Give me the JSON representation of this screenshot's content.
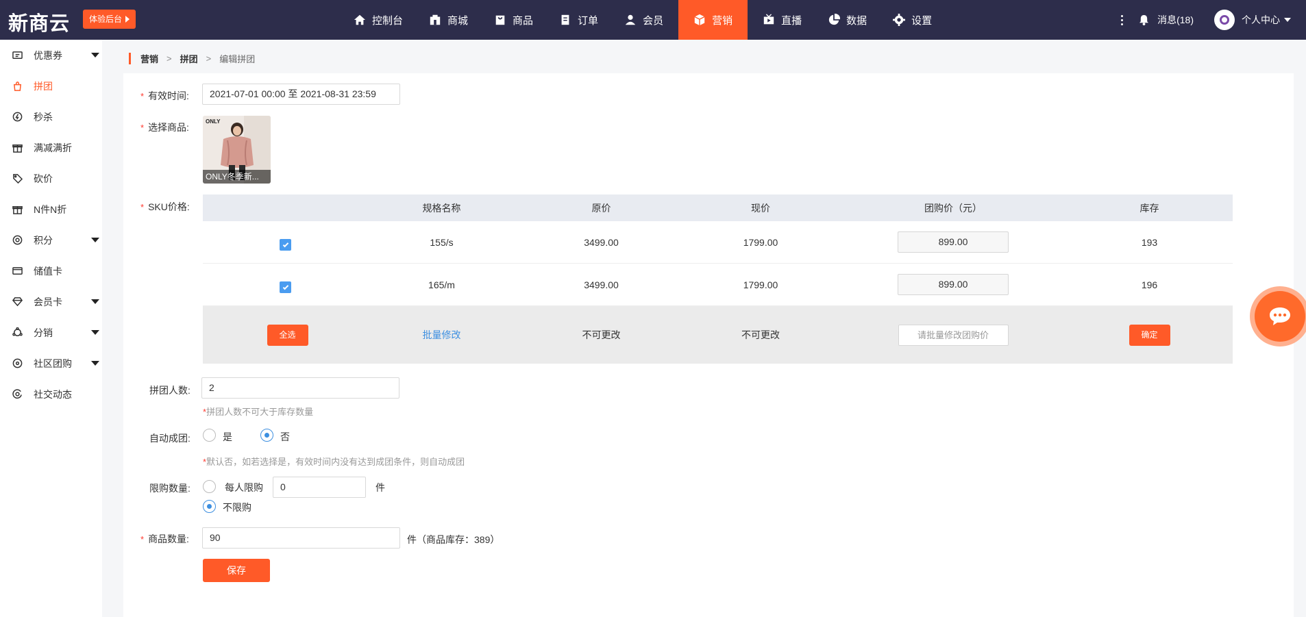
{
  "header": {
    "logo": "新商云",
    "trial_button": "体验后台",
    "nav": [
      {
        "label": "控制台",
        "icon": "home-icon"
      },
      {
        "label": "商城",
        "icon": "store-icon"
      },
      {
        "label": "商品",
        "icon": "bag-icon"
      },
      {
        "label": "订单",
        "icon": "order-icon"
      },
      {
        "label": "会员",
        "icon": "user-icon"
      },
      {
        "label": "营销",
        "icon": "cube-icon",
        "active": true
      },
      {
        "label": "直播",
        "icon": "live-icon"
      },
      {
        "label": "数据",
        "icon": "pie-chart-icon"
      },
      {
        "label": "设置",
        "icon": "gear-icon"
      }
    ],
    "messages": "消息(18)",
    "user_center": "个人中心"
  },
  "sidebar": {
    "items": [
      {
        "label": "优惠券",
        "icon": "coupon-icon",
        "has_caret": true
      },
      {
        "label": "拼团",
        "icon": "group-buy-icon",
        "active": true
      },
      {
        "label": "秒杀",
        "icon": "flash-icon"
      },
      {
        "label": "满减满折",
        "icon": "gift-icon"
      },
      {
        "label": "砍价",
        "icon": "tag-icon"
      },
      {
        "label": "N件N折",
        "icon": "gift-icon"
      },
      {
        "label": "积分",
        "icon": "points-icon",
        "has_caret": true
      },
      {
        "label": "储值卡",
        "icon": "card-icon"
      },
      {
        "label": "会员卡",
        "icon": "diamond-icon",
        "has_caret": true
      },
      {
        "label": "分销",
        "icon": "share-icon",
        "has_caret": true
      },
      {
        "label": "社区团购",
        "icon": "community-icon",
        "has_caret": true
      },
      {
        "label": "社交动态",
        "icon": "social-icon"
      }
    ]
  },
  "breadcrumb": {
    "first": "营销",
    "second": "拼团",
    "third": "编辑拼团",
    "sep": ">"
  },
  "form": {
    "valid_time": {
      "label": "有效时间:",
      "value": "2021-07-01 00:00 至 2021-08-31 23:59"
    },
    "product": {
      "label": "选择商品:",
      "brand": "ONLY",
      "caption": "ONLY冬季新..."
    },
    "sku": {
      "label": "SKU价格:",
      "headers": [
        "",
        "规格名称",
        "原价",
        "现价",
        "团购价（元）",
        "库存"
      ],
      "rows": [
        {
          "spec": "155/s",
          "original": "3499.00",
          "current": "1799.00",
          "group_price": "899.00",
          "stock": "193",
          "checked": true
        },
        {
          "spec": "165/m",
          "original": "3499.00",
          "current": "1799.00",
          "group_price": "899.00",
          "stock": "196",
          "checked": true
        }
      ],
      "select_all": "全选",
      "batch_modify": "批量修改",
      "not_editable": "不可更改",
      "batch_placeholder": "请批量修改团购价",
      "confirm": "确定"
    },
    "group_size": {
      "label": "拼团人数:",
      "value": "2",
      "hint": "拼团人数不可大于库存数量"
    },
    "auto_group": {
      "label": "自动成团:",
      "yes": "是",
      "no": "否",
      "selected": "no",
      "hint": "默认否，如若选择是，有效时间内没有达到成团条件，则自动成团"
    },
    "purchase_limit": {
      "label": "限购数量:",
      "per_person": "每人限购",
      "value": "0",
      "unit": "件",
      "unlimited": "不限购",
      "selected": "unlimited"
    },
    "quantity": {
      "label": "商品数量:",
      "value": "90",
      "suffix": "件（商品库存：389）"
    },
    "save": "保存"
  },
  "colors": {
    "accent": "#ff5a28",
    "topbar": "#2d2d4b",
    "link": "#3d8fe0"
  }
}
